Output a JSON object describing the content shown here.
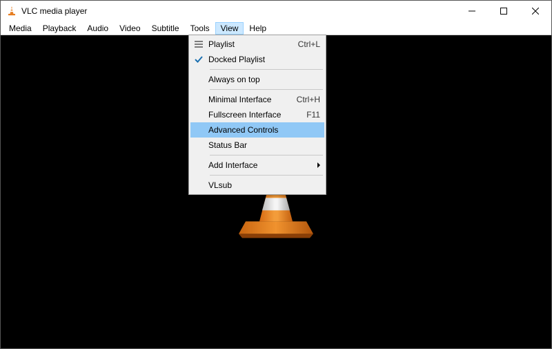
{
  "window": {
    "title": "VLC media player"
  },
  "menubar": {
    "items": [
      {
        "label": "Media"
      },
      {
        "label": "Playback"
      },
      {
        "label": "Audio"
      },
      {
        "label": "Video"
      },
      {
        "label": "Subtitle"
      },
      {
        "label": "Tools"
      },
      {
        "label": "View"
      },
      {
        "label": "Help"
      }
    ],
    "open_index": 6
  },
  "view_menu": {
    "items": [
      {
        "label": "Playlist",
        "shortcut": "Ctrl+L",
        "icon": "list"
      },
      {
        "label": "Docked Playlist",
        "shortcut": "",
        "icon": "check"
      },
      {
        "sep": true
      },
      {
        "label": "Always on top",
        "shortcut": "",
        "icon": ""
      },
      {
        "sep": true
      },
      {
        "label": "Minimal Interface",
        "shortcut": "Ctrl+H",
        "icon": ""
      },
      {
        "label": "Fullscreen Interface",
        "shortcut": "F11",
        "icon": ""
      },
      {
        "label": "Advanced Controls",
        "shortcut": "",
        "icon": "",
        "highlight": true
      },
      {
        "label": "Status Bar",
        "shortcut": "",
        "icon": ""
      },
      {
        "sep": true
      },
      {
        "label": "Add Interface",
        "shortcut": "",
        "icon": "",
        "submenu": true
      },
      {
        "sep": true
      },
      {
        "label": "VLsub",
        "shortcut": "",
        "icon": ""
      }
    ]
  }
}
